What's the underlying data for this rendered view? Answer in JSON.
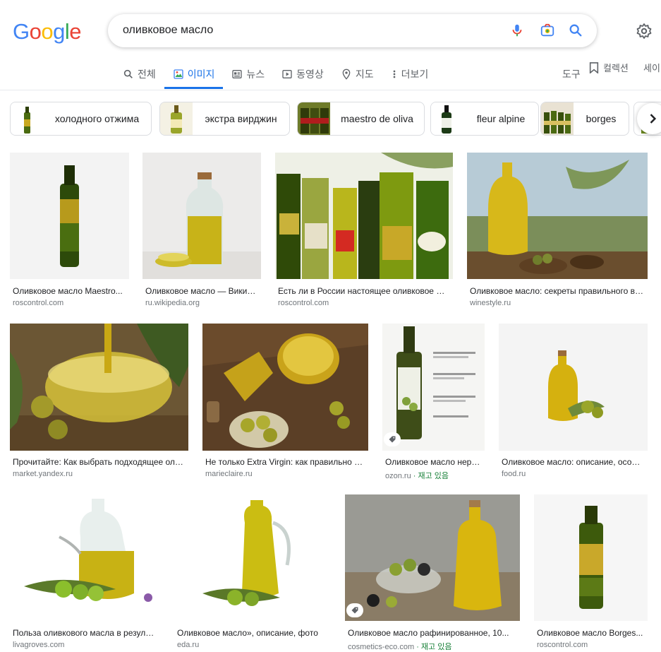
{
  "logo_text": [
    "G",
    "o",
    "o",
    "g",
    "l",
    "e"
  ],
  "search": {
    "query": "оливковое масло"
  },
  "tabs": [
    {
      "label": "전체",
      "icon": "search-icon"
    },
    {
      "label": "이미지",
      "icon": "image-icon",
      "active": true
    },
    {
      "label": "뉴스",
      "icon": "news-icon"
    },
    {
      "label": "동영상",
      "icon": "video-icon"
    },
    {
      "label": "지도",
      "icon": "map-pin-icon"
    },
    {
      "label": "더보기",
      "icon": "more-vert-icon"
    }
  ],
  "toolbar": {
    "tools": "도구",
    "collections": "컬렉션",
    "safesearch": "세이"
  },
  "chips": [
    {
      "label": "холодного отжима"
    },
    {
      "label": "экстра вирджин"
    },
    {
      "label": "maestro de oliva"
    },
    {
      "label": "fleur alpine"
    },
    {
      "label": "borges"
    }
  ],
  "results": [
    {
      "title": "Оливковое масло Maestro...",
      "source": "roscontrol.com"
    },
    {
      "title": "Оливковое масло — Википедия",
      "source": "ru.wikipedia.org"
    },
    {
      "title": "Есть ли в России настоящее оливковое масло",
      "source": "roscontrol.com"
    },
    {
      "title": "Оливковое масло: секреты правильного выбора",
      "source": "winestyle.ru"
    },
    {
      "title": "Прочитайте: Как выбрать подходящее оливковое",
      "source": "market.yandex.ru"
    },
    {
      "title": "Не только Extra Virgin: как правильно выбрать",
      "source": "marieclaire.ru"
    },
    {
      "title": "Оливковое масло нерафинированное",
      "source": "ozon.ru",
      "stock": " · 재고 있음"
    },
    {
      "title": "Оливковое масло: описание, особенности",
      "source": "food.ru"
    },
    {
      "title": "Польза оливкового масла в результате",
      "source": "livagroves.com"
    },
    {
      "title": "Оливковое масло», описание, фото",
      "source": "eda.ru"
    },
    {
      "title": "Оливковое масло рафинированное, 10...",
      "source": "cosmetics-eco.com",
      "stock": " · 재고 있음"
    },
    {
      "title": "Оливковое масло Borges...",
      "source": "roscontrol.com"
    }
  ]
}
